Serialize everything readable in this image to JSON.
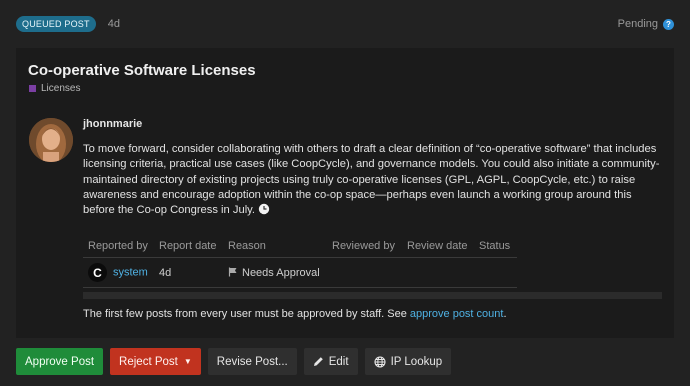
{
  "topbar": {
    "badge": "QUEUED POST",
    "age": "4d",
    "status": "Pending",
    "help_glyph": "?"
  },
  "post": {
    "title": "Co-operative Software Licenses",
    "category": "Licenses",
    "category_color": "#7b3fa3",
    "username": "jhonnmarie",
    "body": "To move forward, consider collaborating with others to draft a clear definition of “co-operative software” that includes licensing criteria, practical use cases (like CoopCycle), and governance models. You could also initiate a community-maintained directory of existing projects using truly co-operative licenses (GPL, AGPL, CoopCycle, etc.) to raise awareness and encourage adoption within the co-op space—perhaps even launch a working group around this before the Co-op Congress in July.",
    "body_icon": "clock-icon"
  },
  "table": {
    "headers": [
      "Reported by",
      "Report date",
      "Reason",
      "Reviewed by",
      "Review date",
      "Status"
    ],
    "rows": [
      {
        "reporter_avatar_letter": "C",
        "reporter": "system",
        "report_date": "4d",
        "reason": "Needs Approval",
        "reviewed_by": "",
        "review_date": "",
        "status": ""
      }
    ]
  },
  "notice": {
    "text": "The first few posts from every user must be approved by staff. See ",
    "link": "approve post count",
    "end": "."
  },
  "actions": {
    "approve": "Approve Post",
    "reject": "Reject Post",
    "revise": "Revise Post...",
    "edit": "Edit",
    "ip_lookup": "IP Lookup"
  },
  "colors": {
    "approve": "#1f8c3a",
    "reject": "#c1331f",
    "link": "#4fb1e3",
    "badge": "#1e6d8c"
  }
}
